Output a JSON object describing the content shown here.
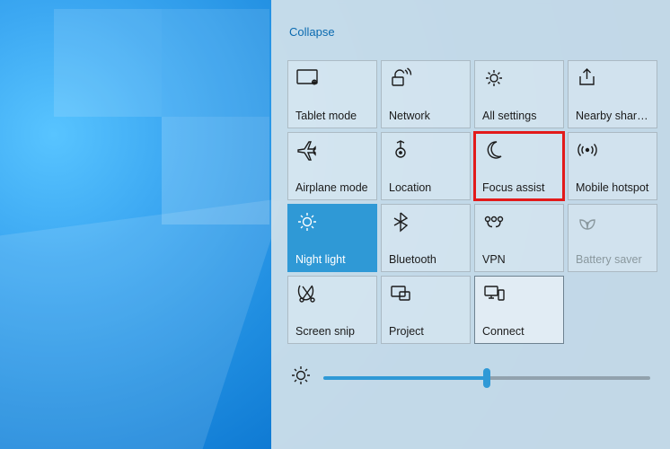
{
  "collapse_label": "Collapse",
  "brightness": {
    "value": 50
  },
  "tiles": [
    {
      "id": "tablet-mode",
      "label": "Tablet mode",
      "icon": "tablet",
      "active": false,
      "disabled": false,
      "highlight": false,
      "selected": false
    },
    {
      "id": "network",
      "label": "Network",
      "icon": "network",
      "active": false,
      "disabled": false,
      "highlight": false,
      "selected": false
    },
    {
      "id": "all-settings",
      "label": "All settings",
      "icon": "gear",
      "active": false,
      "disabled": false,
      "highlight": false,
      "selected": false
    },
    {
      "id": "nearby-sharing",
      "label": "Nearby sharing",
      "icon": "share",
      "active": false,
      "disabled": false,
      "highlight": false,
      "selected": false
    },
    {
      "id": "airplane-mode",
      "label": "Airplane mode",
      "icon": "airplane",
      "active": false,
      "disabled": false,
      "highlight": false,
      "selected": false
    },
    {
      "id": "location",
      "label": "Location",
      "icon": "location",
      "active": false,
      "disabled": false,
      "highlight": false,
      "selected": false
    },
    {
      "id": "focus-assist",
      "label": "Focus assist",
      "icon": "moon",
      "active": false,
      "disabled": false,
      "highlight": true,
      "selected": false
    },
    {
      "id": "mobile-hotspot",
      "label": "Mobile hotspot",
      "icon": "hotspot",
      "active": false,
      "disabled": false,
      "highlight": false,
      "selected": false
    },
    {
      "id": "night-light",
      "label": "Night light",
      "icon": "sun",
      "active": true,
      "disabled": false,
      "highlight": false,
      "selected": false
    },
    {
      "id": "bluetooth",
      "label": "Bluetooth",
      "icon": "bluetooth",
      "active": false,
      "disabled": false,
      "highlight": false,
      "selected": false
    },
    {
      "id": "vpn",
      "label": "VPN",
      "icon": "vpn",
      "active": false,
      "disabled": false,
      "highlight": false,
      "selected": false
    },
    {
      "id": "battery-saver",
      "label": "Battery saver",
      "icon": "leaf",
      "active": false,
      "disabled": true,
      "highlight": false,
      "selected": false
    },
    {
      "id": "screen-snip",
      "label": "Screen snip",
      "icon": "snip",
      "active": false,
      "disabled": false,
      "highlight": false,
      "selected": false
    },
    {
      "id": "project",
      "label": "Project",
      "icon": "project",
      "active": false,
      "disabled": false,
      "highlight": false,
      "selected": false
    },
    {
      "id": "connect",
      "label": "Connect",
      "icon": "connect",
      "active": false,
      "disabled": false,
      "highlight": false,
      "selected": true
    }
  ]
}
